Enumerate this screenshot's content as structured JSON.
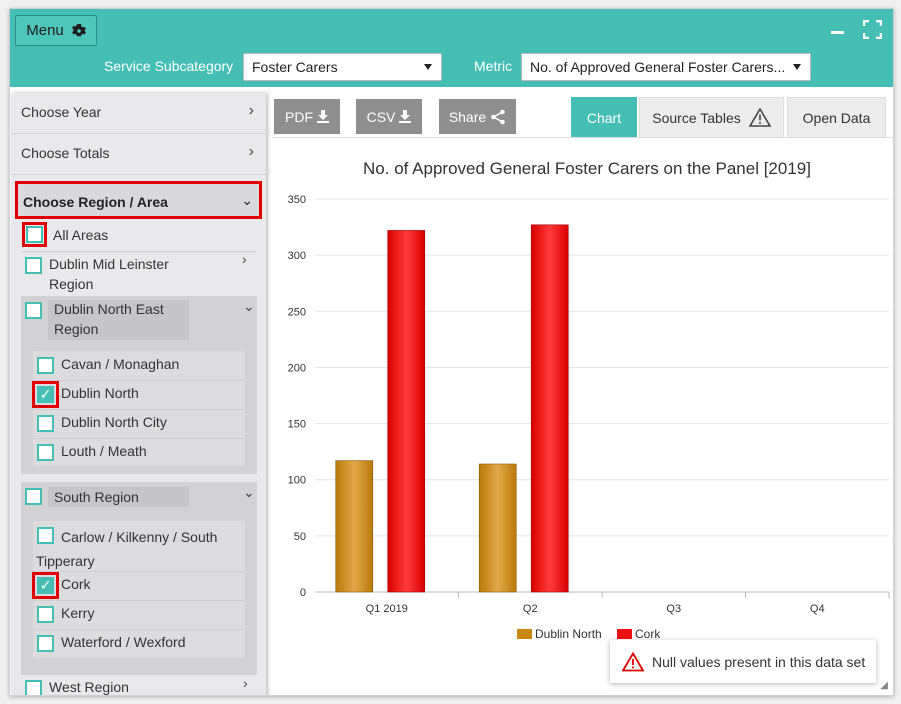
{
  "topbar": {
    "menu_label": "Menu",
    "menu_icon": "gear-icon",
    "minimize_icon": "minimize-icon",
    "fullscreen_icon": "fullscreen-icon",
    "subcategory_label": "Service Subcategory",
    "subcategory_value": "Foster Carers",
    "metric_label": "Metric",
    "metric_value": "No. of Approved General Foster Carers..."
  },
  "sidebar": {
    "choose_year": "Choose Year",
    "choose_totals": "Choose Totals",
    "choose_region": "Choose Region / Area",
    "all_areas": "All Areas",
    "dublin_mid_leinster": "Dublin Mid Leinster Region",
    "dublin_north_east": "Dublin North East Region",
    "dne_areas": [
      {
        "label": "Cavan / Monaghan",
        "checked": false
      },
      {
        "label": "Dublin North",
        "checked": true
      },
      {
        "label": "Dublin North City",
        "checked": false
      },
      {
        "label": "Louth / Meath",
        "checked": false
      }
    ],
    "south_region": "South Region",
    "south_areas": [
      {
        "label": "Carlow / Kilkenny / South Tipperary",
        "checked": false
      },
      {
        "label": "Cork",
        "checked": true
      },
      {
        "label": "Kerry",
        "checked": false
      },
      {
        "label": "Waterford / Wexford",
        "checked": false
      }
    ],
    "west_region": "West Region"
  },
  "toolbar": {
    "pdf_label": "PDF",
    "csv_label": "CSV",
    "share_label": "Share"
  },
  "tabs": {
    "chart": "Chart",
    "source_tables": "Source Tables",
    "open_data": "Open Data"
  },
  "chart_data": {
    "type": "bar",
    "title": "No. of Approved General Foster Carers on the Panel [2019]",
    "categories": [
      "Q1 2019",
      "Q2",
      "Q3",
      "Q4"
    ],
    "series": [
      {
        "name": "Dublin North",
        "values": [
          117,
          114,
          null,
          null
        ],
        "color": "#c9880f"
      },
      {
        "name": "Cork",
        "values": [
          322,
          327,
          null,
          null
        ],
        "color": "#ee1010"
      }
    ],
    "ylim": [
      0,
      350
    ],
    "yticks": [
      0,
      50,
      100,
      150,
      200,
      250,
      300,
      350
    ],
    "grid": true,
    "legend": "bottom"
  },
  "notice": {
    "text": "Null values present in this data set",
    "icon": "warning-icon"
  }
}
